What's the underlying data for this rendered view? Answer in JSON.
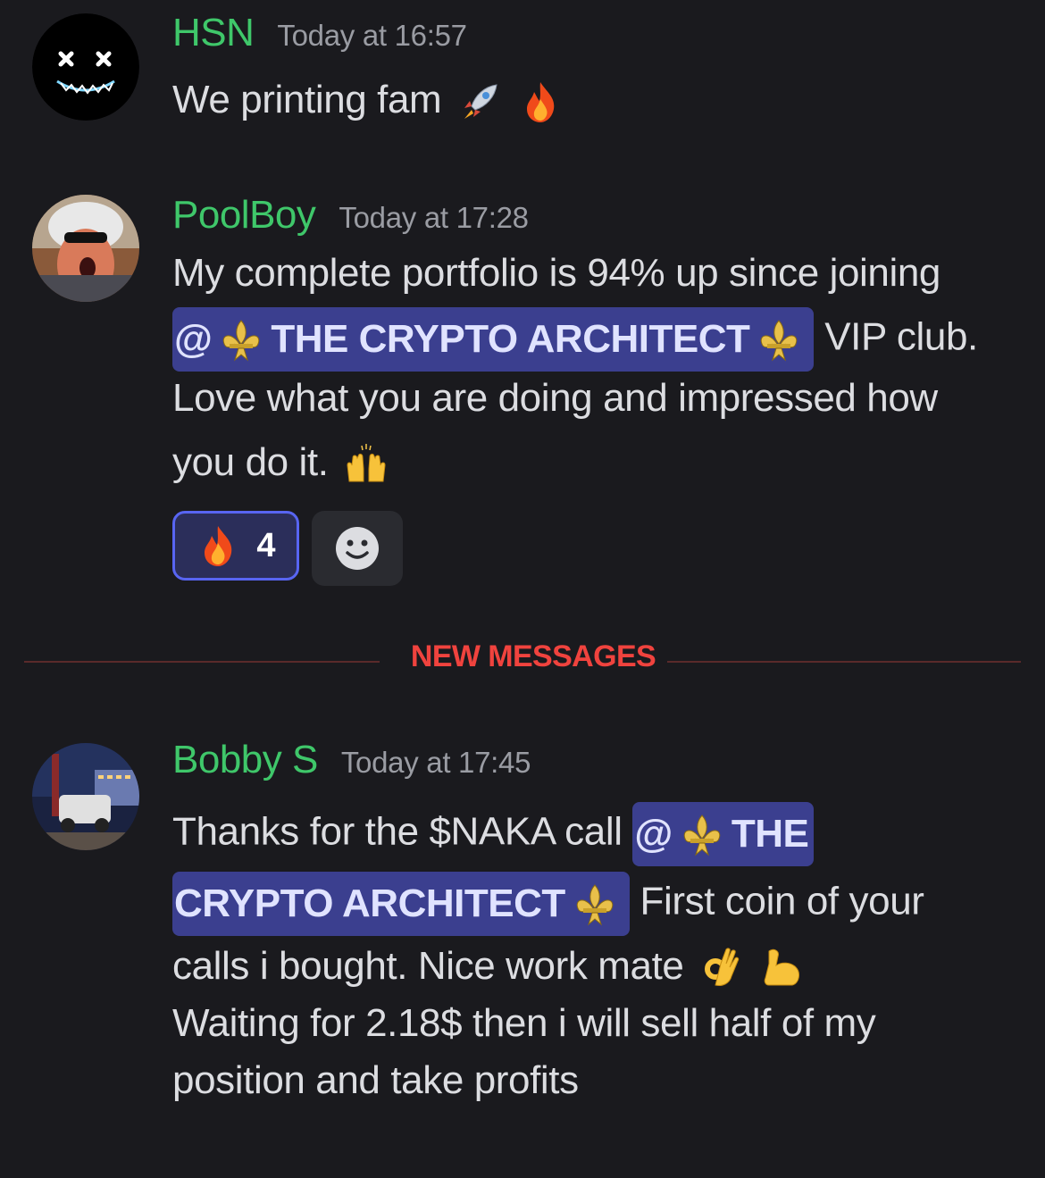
{
  "messages": [
    {
      "author": "HSN",
      "timestamp": "Today at 16:57",
      "text": "We printing fam",
      "emojis": [
        "rocket-emoji",
        "fire-emoji"
      ]
    },
    {
      "author": "PoolBoy",
      "timestamp": "Today at 17:28",
      "line1": "My complete portfolio is 94% up since joining",
      "mention": "@",
      "mention_name": "THE CRYPTO ARCHITECT",
      "line2_after": "VIP club.",
      "line3": "Love what you are doing and impressed how",
      "line4": "you do it.",
      "reactions": [
        {
          "emoji": "fire-emoji",
          "count": "4"
        }
      ]
    },
    {
      "author": "Bobby S",
      "timestamp": "Today at 17:45",
      "line1_before": "Thanks for the $NAKA call",
      "mention": "@",
      "mention_part1": "THE",
      "mention_part2": "CRYPTO ARCHITECT",
      "line2_after": "First coin of your",
      "line3": "calls i bought. Nice work mate",
      "line4": "Waiting for 2.18$ then i will sell half of my",
      "line5": "position and take profits"
    }
  ],
  "divider": {
    "label": "NEW MESSAGES"
  },
  "colors": {
    "background": "#1a1a1e",
    "author": "#3fc76a",
    "mention_bg": "#3b3f8f",
    "new_messages": "#f0433e",
    "reaction_border": "#5865f2"
  }
}
